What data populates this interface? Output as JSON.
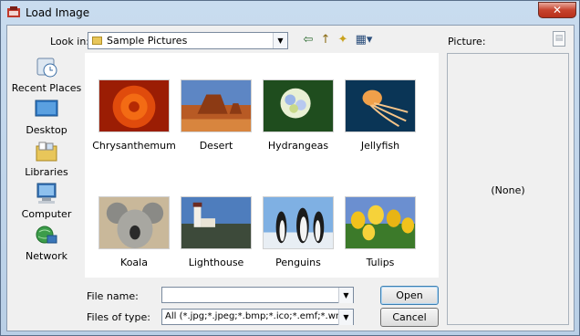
{
  "window": {
    "title": "Load Image",
    "close_glyph": "✕"
  },
  "lookin": {
    "label": "Look in:",
    "value": "Sample Pictures",
    "arrow": "▼"
  },
  "toolbar": {
    "back_glyph": "⇦",
    "up_glyph": "↑",
    "newfolder_glyph": "✦",
    "views_glyph": "▦▾"
  },
  "preview": {
    "label": "Picture:",
    "none_text": "(None)"
  },
  "places": [
    {
      "label": "Recent Places",
      "icon": "recent-places-icon"
    },
    {
      "label": "Desktop",
      "icon": "desktop-icon"
    },
    {
      "label": "Libraries",
      "icon": "libraries-icon"
    },
    {
      "label": "Computer",
      "icon": "computer-icon"
    },
    {
      "label": "Network",
      "icon": "network-icon"
    }
  ],
  "files": [
    {
      "name": "Chrysanthemum"
    },
    {
      "name": "Desert"
    },
    {
      "name": "Hydrangeas"
    },
    {
      "name": "Jellyfish"
    },
    {
      "name": "Koala"
    },
    {
      "name": "Lighthouse"
    },
    {
      "name": "Penguins"
    },
    {
      "name": "Tulips"
    }
  ],
  "filename": {
    "label": "File name:",
    "value": ""
  },
  "filetype": {
    "label": "Files of type:",
    "value": "All (*.jpg;*.jpeg;*.bmp;*.ico;*.emf;*.wmf)"
  },
  "buttons": {
    "open": "Open",
    "cancel": "Cancel"
  },
  "colors": {
    "title_bar": "#c9dcef",
    "close_red": "#c7432d",
    "dialog_bg": "#f0f0f0"
  }
}
